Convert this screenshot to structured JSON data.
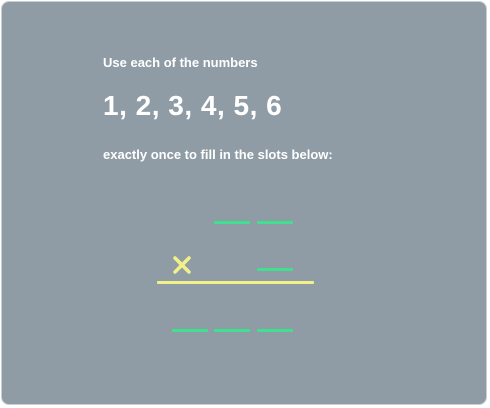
{
  "puzzle": {
    "instruction_top": "Use each of the numbers",
    "numbers": "1, 2, 3, 4, 5, 6",
    "instruction_bottom": "exactly once to fill in the slots below:",
    "operator_icon": "multiply-icon",
    "colors": {
      "background": "#8f9ca5",
      "slot": "#3fe08f",
      "operator": "#f2f088",
      "text": "#ffffff"
    }
  }
}
